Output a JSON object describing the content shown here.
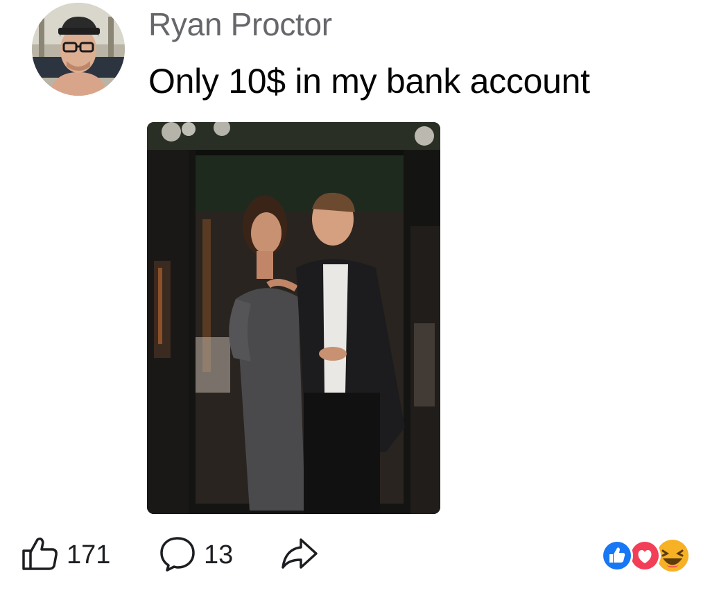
{
  "post": {
    "author_name": "Ryan Proctor",
    "text": "Only 10$ in my bank account"
  },
  "actions": {
    "like_count": "171",
    "comment_count": "13"
  },
  "reactions": [
    "like",
    "love",
    "haha"
  ],
  "icons": {
    "like": "thumbs-up-outline-icon",
    "comment": "speech-bubble-icon",
    "share": "share-arrow-icon"
  },
  "colors": {
    "like_reaction": "#1877f2",
    "love_reaction": "#f33e58",
    "haha_reaction": "#f7b125",
    "author_name": "#65676b",
    "text": "#050505"
  }
}
